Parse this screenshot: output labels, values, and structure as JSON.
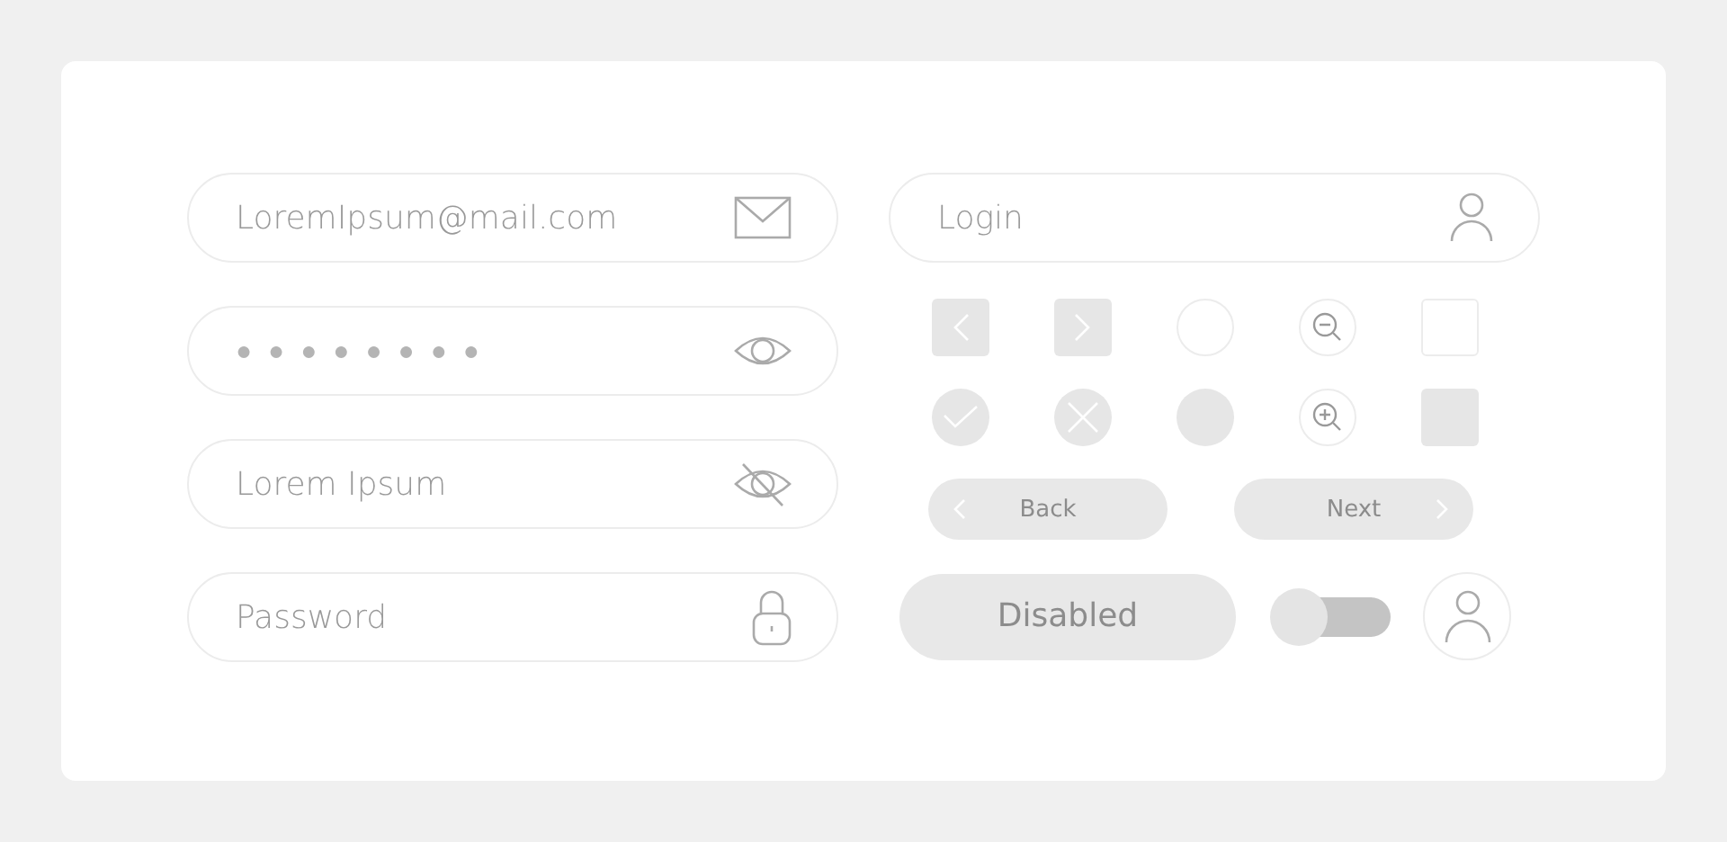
{
  "fields": [
    {
      "kind": "email",
      "value": "LoremIpsum@mail.com"
    },
    {
      "kind": "masked",
      "value": "●●●●●●●●"
    },
    {
      "kind": "text",
      "placeholder": "Lorem Ipsum"
    },
    {
      "kind": "password",
      "placeholder": "Password"
    }
  ],
  "login": {
    "kind": "login",
    "placeholder": "Login"
  },
  "icon_buttons": [
    {
      "kind": "arrow-left"
    },
    {
      "kind": "arrow-right"
    },
    {
      "kind": "radio",
      "checked": false
    },
    {
      "kind": "zoom-out"
    },
    {
      "kind": "checkbox",
      "checked": false
    },
    {
      "kind": "check"
    },
    {
      "kind": "cross"
    },
    {
      "kind": "radio",
      "checked": true
    },
    {
      "kind": "zoom-in"
    },
    {
      "kind": "checkbox",
      "checked": true
    }
  ],
  "nav_buttons": [
    {
      "kind": "back",
      "label": "Back"
    },
    {
      "kind": "next",
      "label": "Next"
    }
  ],
  "disabled_button": {
    "label": "Disabled",
    "disabled": true
  },
  "toggle": {
    "on": false
  }
}
